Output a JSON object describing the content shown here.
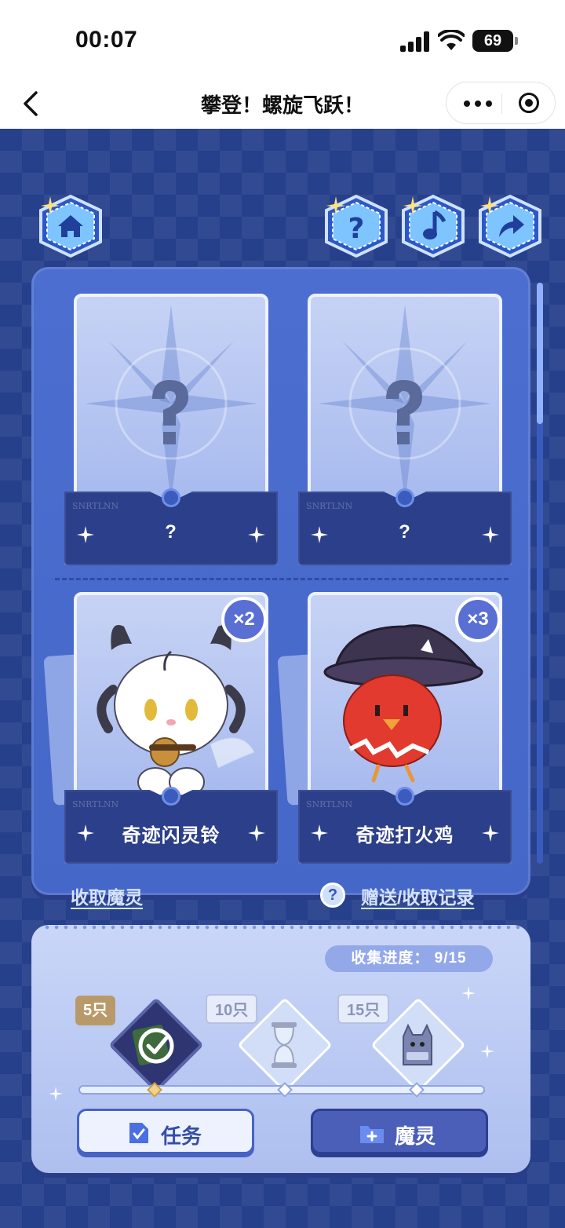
{
  "status_bar": {
    "time": "00:07",
    "battery": "69"
  },
  "nav": {
    "title": "攀登！螺旋飞跃！"
  },
  "top_icons": [
    "home-icon",
    "help-icon",
    "music-icon",
    "share-icon"
  ],
  "cards": [
    {
      "name": "?",
      "mystery": true,
      "count": ""
    },
    {
      "name": "?",
      "mystery": true,
      "count": ""
    },
    {
      "name": "奇迹闪灵铃",
      "mystery": false,
      "count": "×2"
    },
    {
      "name": "奇迹打火鸡",
      "mystery": false,
      "count": "×3"
    }
  ],
  "card_tag": "SNRTLNN",
  "links": {
    "receive": "收取魔灵",
    "records": "赠送/收取记录",
    "help_mark": "?"
  },
  "collection": {
    "progress_label": "收集进度： 9/15",
    "milestones": [
      {
        "label": "5只",
        "reached": true
      },
      {
        "label": "10只",
        "reached": false
      },
      {
        "label": "15只",
        "reached": false
      }
    ]
  },
  "buttons": {
    "task": "任务",
    "spirit": "魔灵"
  },
  "colors": {
    "bg": "#27408c",
    "panel": "#4567c8",
    "accent_gold": "#e8b84a"
  }
}
